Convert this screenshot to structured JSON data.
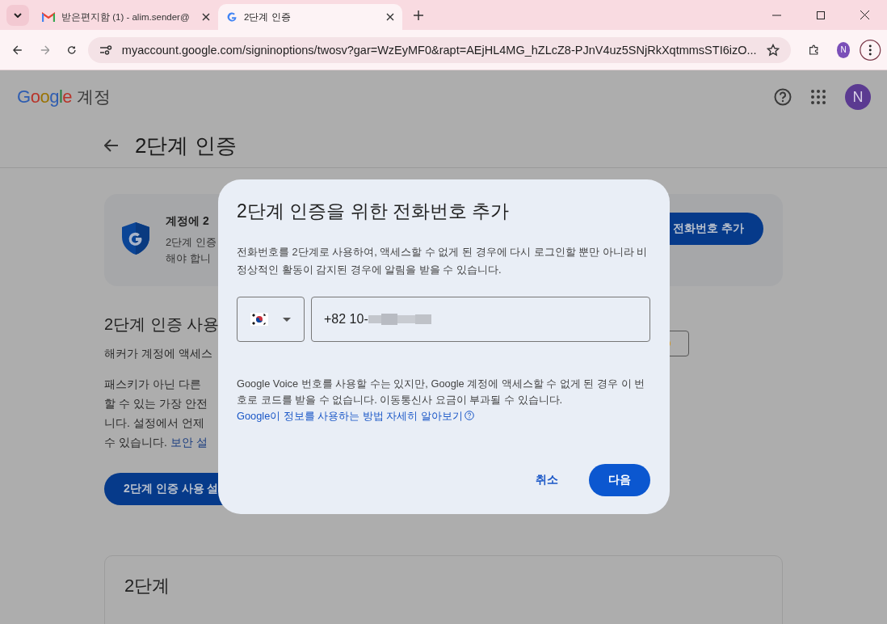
{
  "browser": {
    "tabs": [
      {
        "kind": "mail",
        "title": "받은편지함 (1) - alim.sender@",
        "selected": false
      },
      {
        "kind": "google",
        "title": "2단계 인증",
        "selected": true
      }
    ],
    "url": "myaccount.google.com/signinoptions/twosv?gar=WzEyMF0&rapt=AEjHL4MG_hZLcZ8-PJnV4uz5SNjRkXqtmmsSTI6izO...",
    "profile_initial": "N"
  },
  "header": {
    "logo": "Google",
    "product": "계정",
    "avatar_initial": "N"
  },
  "page": {
    "title": "2단계 인증",
    "card": {
      "title": "계정에 2",
      "lines": [
        "2단계 인증",
        "해야 합니"
      ],
      "button": "전화번호 추가"
    },
    "section": {
      "heading": "2단계 인증 사용",
      "intro": "해커가 계정에 액세스",
      "lines": [
        "패스키가 아닌 다른",
        "할 수 있는 가장 안전",
        "니다. 설정에서 언제",
        "수 있습니다."
      ],
      "link": "보안 설",
      "button": "2단계 인증 사용 설"
    },
    "steps_card": {
      "heading": "2단계"
    }
  },
  "dialog": {
    "title": "2단계 인증을 위한 전화번호 추가",
    "body": "전화번호를 2단계로 사용하여, 액세스할 수 없게 된 경우에 다시 로그인할 뿐만 아니라 비정상적인 활동이 감지된 경우에 알림을 받을 수 있습니다.",
    "phone_value": "+82 10-",
    "note": "Google Voice 번호를 사용할 수는 있지만, Google 계정에 액세스할 수 없게 된 경우 이 번호로 코드를 받을 수 없습니다. 이동통신사 요금이 부과될 수 있습니다.",
    "note_link": "Google이 정보를 사용하는 방법 자세히 알아보기",
    "buttons": [
      {
        "kind": "text",
        "label": "취소"
      },
      {
        "kind": "filled",
        "label": "다음"
      }
    ]
  }
}
